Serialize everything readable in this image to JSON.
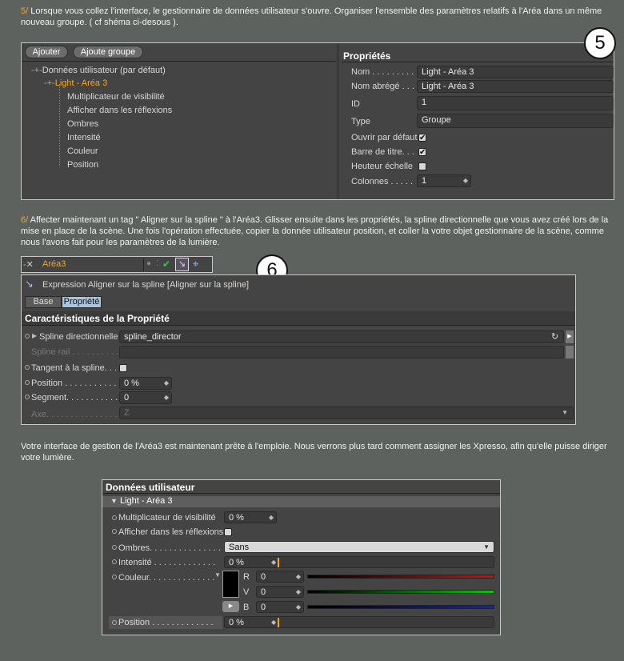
{
  "step5": {
    "num": "5/",
    "text": " Lorsque vous collez l'interface, le gestionnaire de données utilisateur s'ouvre. Organiser l'ensemble des paramètres relatifs à l'Aréa dans un même nouveau groupe. ( cf shéma ci-desous )."
  },
  "step6": {
    "num": "6/",
    "text": " Affecter maintenant un tag \" Aligner sur la spline \" à l'Aréa3. Glisser ensuite dans les propriétés, la spline directionnelle que vous avez créé lors de la mise en place de la scène. Une fois l'opération effectuée, copier la donnée utilisateur position, et coller la votre objet gestionnaire de la scène, comme nous l'avons fait pour les paramètres de la lumière."
  },
  "conclusion": "Votre interface de gestion de l'Aréa3 est maintenant prête à l'emploie. Nous verrons plus tard comment assigner les Xpresso, afin qu'elle puisse diriger votre lumière.",
  "badge5": "5",
  "badge6": "6",
  "panel1": {
    "add_btn": "Ajouter",
    "add_group_btn": "Ajoute groupe",
    "tree_root": "Données utilisateur (par défaut)",
    "tree_group": "Light - Aréa 3",
    "tree_items": [
      "Multiplicateur de visibilité",
      "Afficher dans les réflexions",
      "Ombres",
      "Intensité",
      "Couleur",
      "Position"
    ],
    "props_title": "Propriétés",
    "nom_label": "Nom . . . . . . . . .",
    "nom_value": "Light - Aréa 3",
    "abrege_label": "Nom abrégé . . .",
    "abrege_value": "Light - Aréa 3",
    "id_label": "ID",
    "id_value": "1",
    "type_label": "Type",
    "type_value": "Groupe",
    "ouvrir_label": "Ouvrir par défaut",
    "barre_label": "Barre de titre. . .",
    "hauteur_label": "Heuteur échelle",
    "colonnes_label": "Colonnes . . . . .",
    "colonnes_value": "1",
    "check_mark": "✔"
  },
  "obj_bar": {
    "name": "Aréa3"
  },
  "panel2": {
    "title": "Expression Aligner sur la spline [Aligner sur la spline]",
    "tab_base": "Base",
    "tab_prop": "Propriété",
    "section": "Caractéristiques de la Propriété",
    "spline_label": "Spline directionnelle",
    "spline_value": "spline_director",
    "rail_label": "Spline rail . . . . . . . . . .",
    "tangent_label": "Tangent à la spline. . .",
    "position_label": "Position . . . . . . . . . . .",
    "position_value": "0 %",
    "segment_label": "Segment. . . . . . . . . . .",
    "segment_value": "0",
    "axe_label": "Axe. . . . . . . . . . . . . . .",
    "axe_value": "Z"
  },
  "panel3": {
    "title": "Données utilisateur",
    "group": "Light - Aréa 3",
    "mult_label": "Multiplicateur de visibilité",
    "mult_value": "0 %",
    "reflect_label": "Afficher dans les réflexions",
    "ombres_label": "Ombres. . . . . . . . . . . . . . .",
    "ombres_value": "Sans",
    "intens_label": "Intensité . . . . . . . . . . . . .",
    "intens_value": "0 %",
    "couleur_label": "Couleur. . . . . . . . . . . . . .",
    "r_label": "R",
    "r_value": "0",
    "v_label": "V",
    "v_value": "0",
    "b_label": "B",
    "b_value": "0",
    "pos_label": "Position . . . . . . . . . . . . .",
    "pos_value": "0 %"
  },
  "colors": {
    "accent": "#f5a623",
    "panel": "#444444",
    "red": "#d01010",
    "green": "#10c010",
    "blue": "#1020d0"
  }
}
